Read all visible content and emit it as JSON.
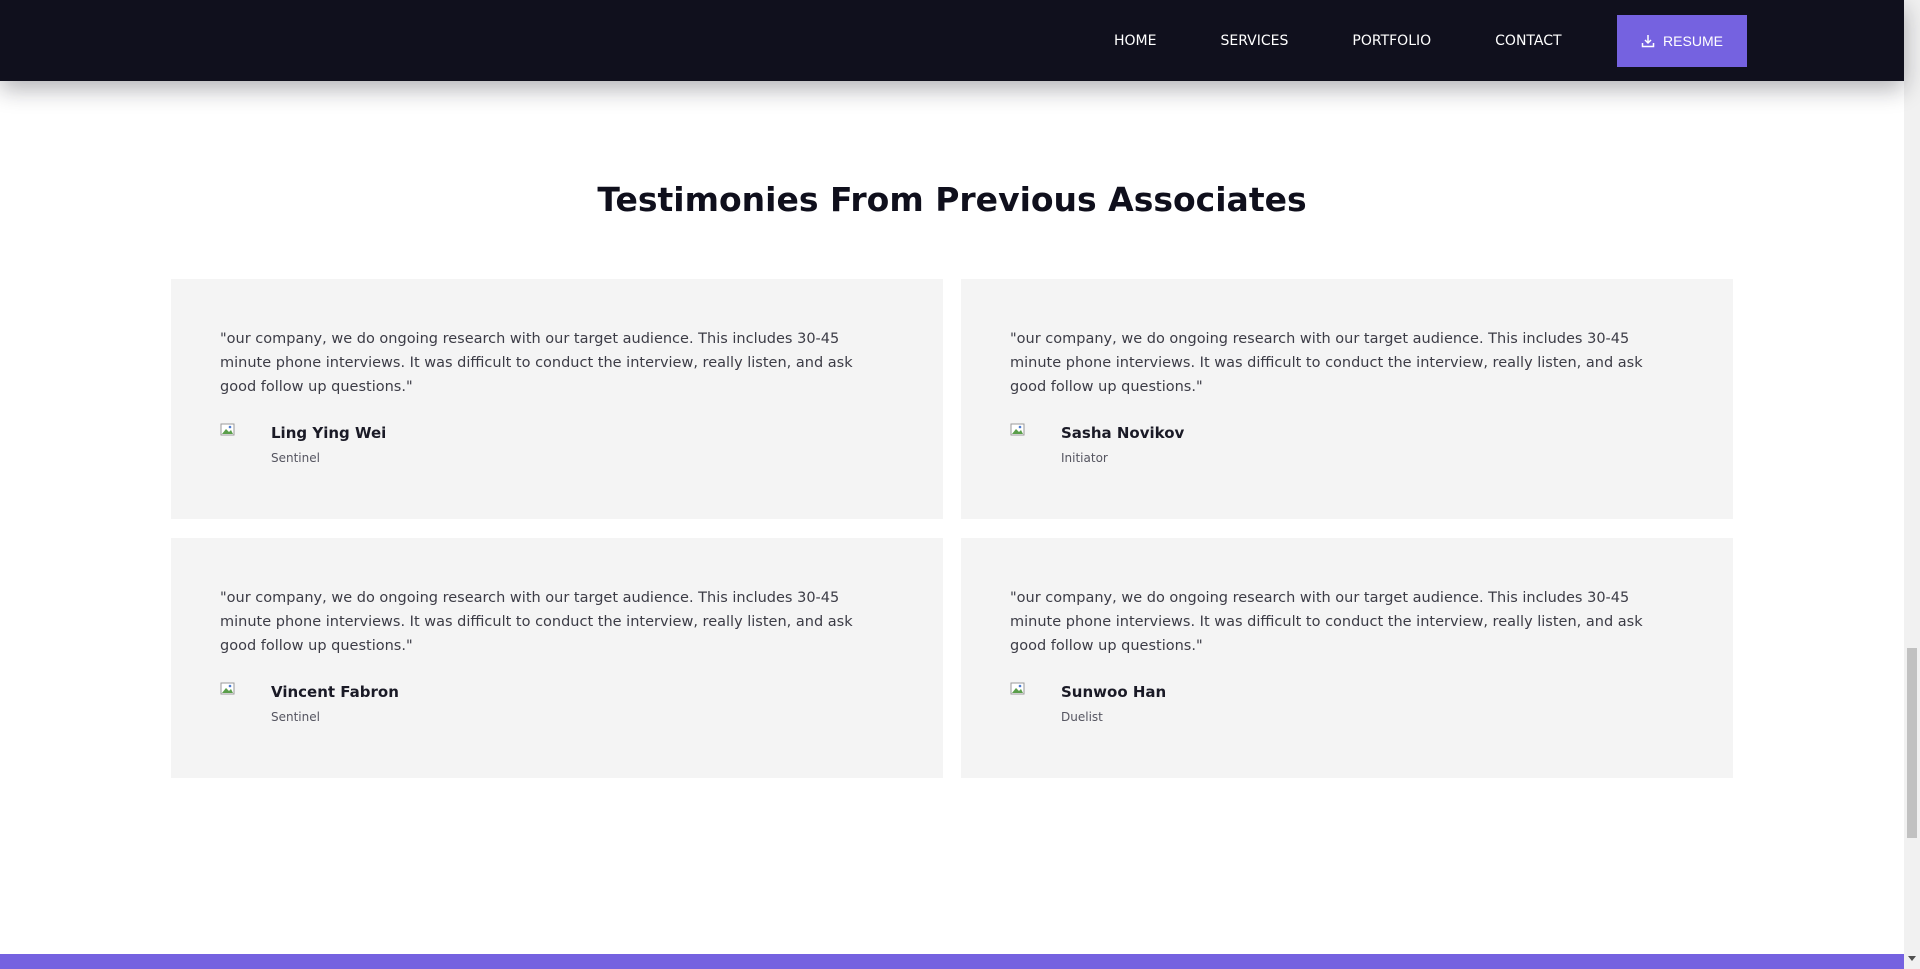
{
  "nav": {
    "links": [
      {
        "label": "HOME"
      },
      {
        "label": "SERVICES"
      },
      {
        "label": "PORTFOLIO"
      },
      {
        "label": "CONTACT"
      }
    ],
    "resume_label": "RESUME",
    "resume_icon": "download-icon"
  },
  "section": {
    "title": "Testimonies From Previous Associates"
  },
  "testimonials": [
    {
      "quote": "\"our company, we do ongoing research with our target audience. This includes 30-45 minute phone interviews. It was difficult to conduct the interview, really listen, and ask good follow up questions.\"",
      "name": "Ling Ying Wei",
      "role": "Sentinel"
    },
    {
      "quote": "\"our company, we do ongoing research with our target audience. This includes 30-45 minute phone interviews. It was difficult to conduct the interview, really listen, and ask good follow up questions.\"",
      "name": "Sasha Novikov",
      "role": "Initiator"
    },
    {
      "quote": "\"our company, we do ongoing research with our target audience. This includes 30-45 minute phone interviews. It was difficult to conduct the interview, really listen, and ask good follow up questions.\"",
      "name": "Vincent Fabron",
      "role": "Sentinel"
    },
    {
      "quote": "\"our company, we do ongoing research with our target audience. This includes 30-45 minute phone interviews. It was difficult to conduct the interview, really listen, and ask good follow up questions.\"",
      "name": "Sunwoo Han",
      "role": "Duelist"
    }
  ],
  "colors": {
    "nav_bg": "#10101d",
    "accent": "#7562e0",
    "card_bg": "#f4f4f4",
    "title": "#0f0f1c"
  }
}
